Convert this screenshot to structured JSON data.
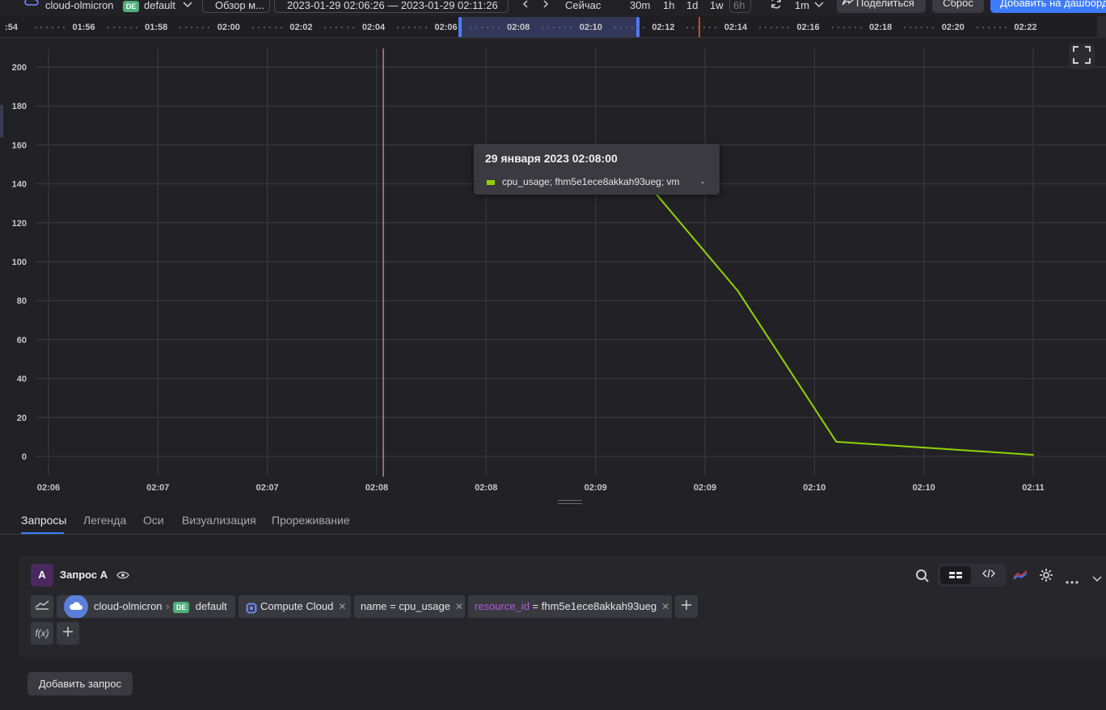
{
  "toolbar": {
    "folder": "cloud-olmicron",
    "folder_badge": "DE",
    "workspace": "default",
    "overview": "Обзор м...",
    "time_range": "2023-01-29 02:06:26 — 2023-01-29 02:11:26",
    "now_label": "Сейчас",
    "range_buttons": [
      "30m",
      "1h",
      "1d",
      "1w",
      "6h"
    ],
    "refresh_interval": "1m",
    "share_label": "Поделиться",
    "reset_label": "Сброс",
    "add_dashboard_label": "Добавить на дашборд"
  },
  "timeline": {
    "ticks": [
      ":54",
      "01:56",
      "01:58",
      "02:00",
      "02:02",
      "02:04",
      "02:06",
      "02:08",
      "02:10",
      "02:12",
      "02:14",
      "02:16",
      "02:18",
      "02:20",
      "02:22"
    ]
  },
  "chart_data": {
    "type": "line",
    "y_ticks": [
      0,
      20,
      40,
      60,
      80,
      100,
      120,
      140,
      160,
      180,
      200
    ],
    "ylim": [
      0,
      200
    ],
    "x_tick_labels": [
      "02:06",
      "02:07",
      "02:07",
      "02:08",
      "02:08",
      "02:09",
      "02:09",
      "02:10",
      "02:10",
      "02:11"
    ],
    "grid": true,
    "series": [
      {
        "name": "cpu_usage; fhm5e1ece8akkah93ueg; vm",
        "color": "#8fd400",
        "x": [
          "02:09:00",
          "02:09:30",
          "02:10:00",
          "02:11:00"
        ],
        "values": [
          145,
          85,
          7.5,
          0.8
        ]
      }
    ],
    "cursor_time": "02:07:42",
    "tooltip": {
      "title": "29 января 2023 02:08:00",
      "row_label": "cpu_usage; fhm5e1ece8akkah93ueg; vm",
      "row_value": "-"
    }
  },
  "tabs": [
    "Запросы",
    "Легенда",
    "Оси",
    "Визуализация",
    "Прореживание"
  ],
  "query": {
    "badge": "A",
    "title": "Запрос A",
    "cloud": "cloud-olmicron",
    "folder_badge": "DE",
    "folder": "default",
    "service": "Compute Cloud",
    "filter_name": "name = cpu_usage",
    "filter_resource_key": "resource_id",
    "filter_resource_op": " = ",
    "filter_resource_value": "fhm5e1ece8akkah93ueg",
    "fx_label": "f(x)"
  },
  "add_query_label": "Добавить запрос"
}
